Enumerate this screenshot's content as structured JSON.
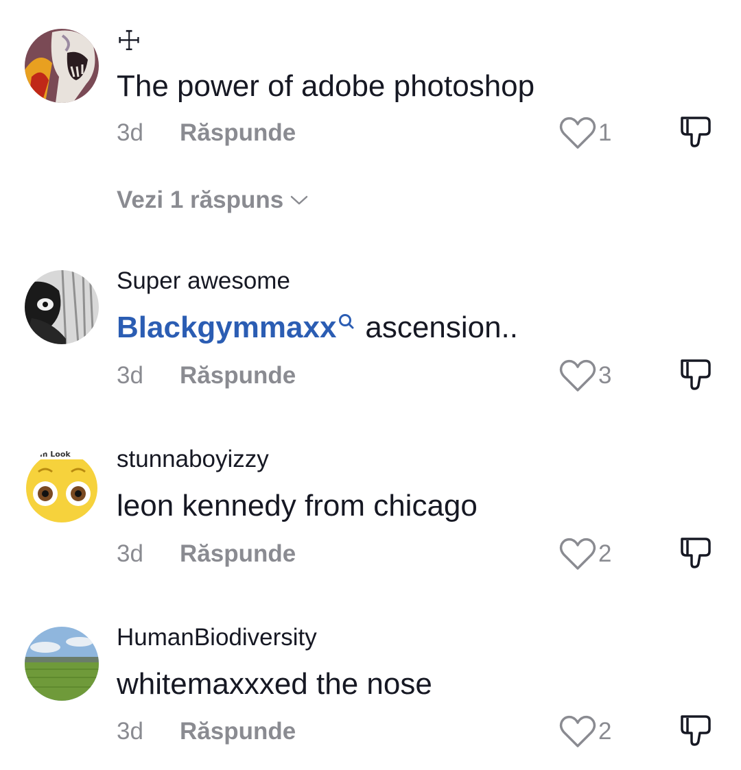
{
  "comments": [
    {
      "username": "☩",
      "text": "The power of adobe photoshop",
      "time": "3d",
      "reply_label": "Răspunde",
      "likes": "1",
      "view_replies": "Vezi 1 răspuns"
    },
    {
      "username": "Super awesome",
      "mention": "Blackgymmaxx",
      "text": "ascension..",
      "time": "3d",
      "reply_label": "Răspunde",
      "likes": "3"
    },
    {
      "username": "stunnaboyizzy",
      "avatar_text": "m Look",
      "text": "leon kennedy from chicago",
      "time": "3d",
      "reply_label": "Răspunde",
      "likes": "2"
    },
    {
      "username": "HumanBiodiversity",
      "text": "whitemaxxxed the nose",
      "time": "3d",
      "reply_label": "Răspunde",
      "likes": "2"
    }
  ],
  "icons": {
    "like": "heart-outline-icon",
    "dislike": "thumbs-down-icon",
    "mention_search": "search-icon",
    "expand": "chevron-down-icon"
  },
  "colors": {
    "text": "#161823",
    "secondary": "#8a8b91",
    "mention": "#2b5db3"
  }
}
